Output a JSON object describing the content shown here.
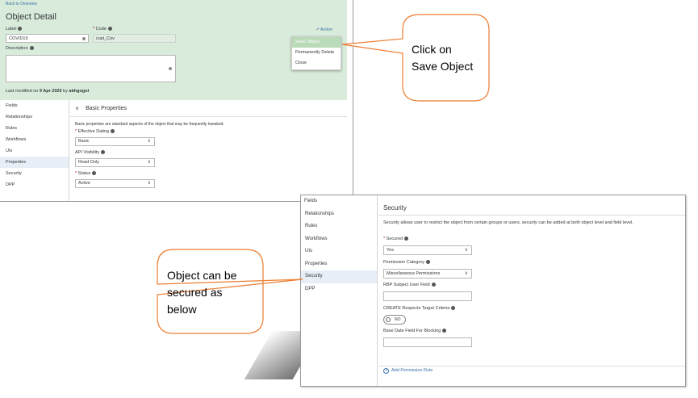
{
  "shot1": {
    "back_link": "Back to Overview",
    "title": "Object Detail",
    "label_caption": "Label",
    "label_value": "COVID19",
    "code_caption": "Code",
    "code_value": "cust_Cov",
    "description_caption": "Description",
    "action_label": "Action",
    "action_menu": [
      "Save Object",
      "Permanently Delete",
      "Close"
    ],
    "last_modified_prefix": "Last modified on",
    "last_modified_date": "9 Apr 2020",
    "last_modified_by_word": "by",
    "last_modified_user": "abhgogoi",
    "nav": [
      "Fields",
      "Relationships",
      "Rules",
      "Workflows",
      "UIs",
      "Properties",
      "Security",
      "DPP"
    ],
    "section_title": "Basic Properties",
    "section_desc": "Basic properties are standard aspects of the object that may be frequently tweaked.",
    "effective_dating_label": "Effective Dating",
    "effective_dating_value": "Basic",
    "api_visibility_label": "API Visibility",
    "api_visibility_value": "Read Only",
    "status_label": "Status",
    "status_value": "Active"
  },
  "shot2": {
    "nav": [
      "Fields",
      "Relationships",
      "Rules",
      "Workflows",
      "UIs",
      "Properties",
      "Security",
      "DPP"
    ],
    "title": "Security",
    "desc": "Security allows user to restrict the object from certain groups or users, security can be added at both object level and field level.",
    "secured_label": "Secured",
    "secured_value": "Yes",
    "permission_category_label": "Permission Category",
    "permission_category_value": "Miscellaneous Permissions",
    "rbp_label": "RBP Subject User Field",
    "create_respects_label": "CREATE Respects Target Criteria",
    "toggle_value": "NO",
    "base_date_label": "Base Date Field For Blocking",
    "add_permission_role": "Add Permission Role"
  },
  "callouts": {
    "save_line1": "Click on",
    "save_line2": "Save Object",
    "secure_line1": "Object can be",
    "secure_line2": "secured as",
    "secure_line3": "below"
  }
}
